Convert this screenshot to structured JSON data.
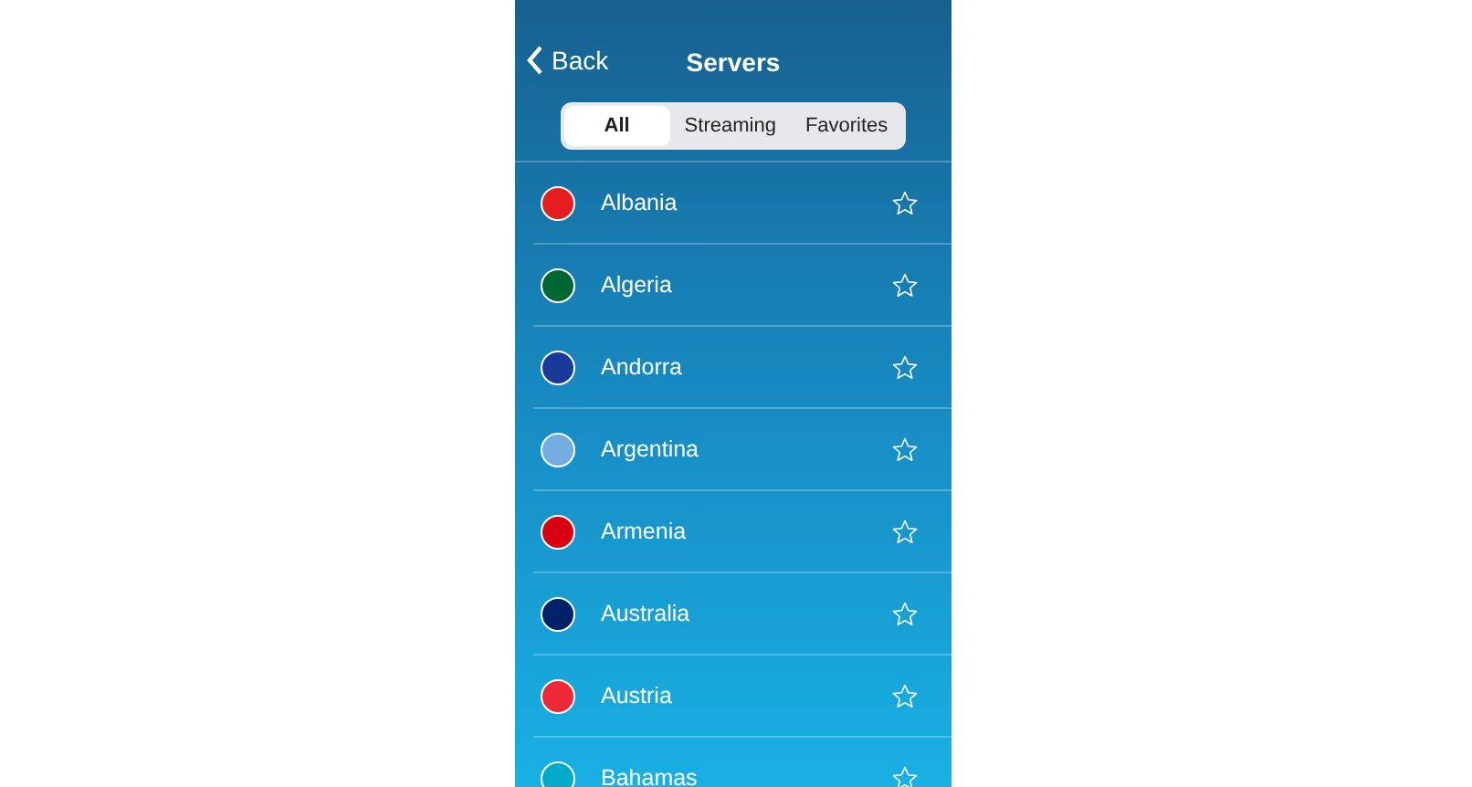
{
  "nav": {
    "back": "Back",
    "title": "Servers"
  },
  "tabs": [
    {
      "label": "All",
      "selected": true
    },
    {
      "label": "Streaming",
      "selected": false
    },
    {
      "label": "Favorites",
      "selected": false
    }
  ],
  "servers": [
    {
      "name": "Albania",
      "color": "#e41e20",
      "favorite": false
    },
    {
      "name": "Algeria",
      "color": "#006633",
      "favorite": false
    },
    {
      "name": "Andorra",
      "color": "#1a3a9a",
      "favorite": false
    },
    {
      "name": "Argentina",
      "color": "#74acdf",
      "favorite": false
    },
    {
      "name": "Armenia",
      "color": "#d90012",
      "favorite": false
    },
    {
      "name": "Australia",
      "color": "#012169",
      "favorite": false
    },
    {
      "name": "Austria",
      "color": "#ed2939",
      "favorite": false
    },
    {
      "name": "Bahamas",
      "color": "#00abc9",
      "favorite": false
    }
  ]
}
